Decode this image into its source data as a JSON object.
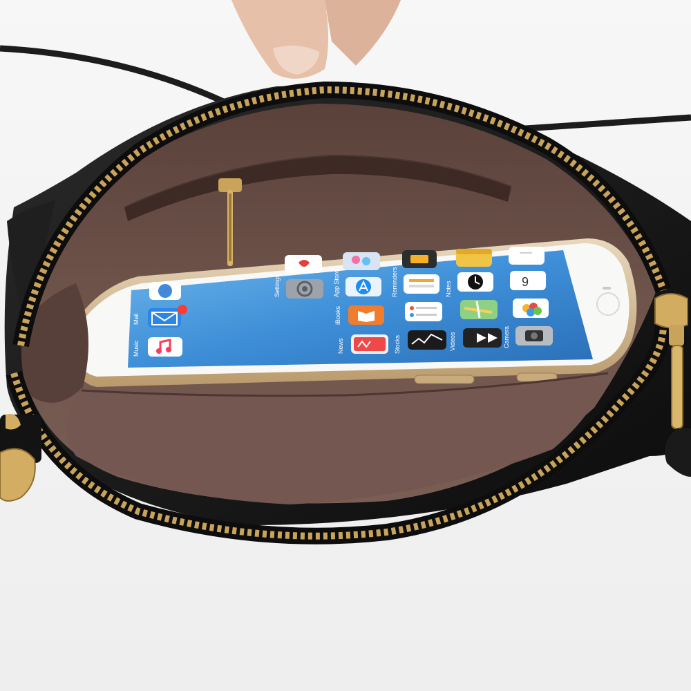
{
  "colors": {
    "background": "#f4f4f4",
    "bag_leather": "#141414",
    "lining": "#6b5048",
    "zipper_gold": "#c9a35a",
    "phone_gold": "#d8bf9a",
    "screen_blue": "#3e8fd8"
  },
  "icons": [
    "mail-icon",
    "music-icon",
    "safari-icon",
    "weather-icon",
    "settings-icon",
    "app-store-icon",
    "ibooks-icon",
    "news-icon",
    "reminders-icon",
    "stocks-icon",
    "notes-icon",
    "clock-icon",
    "maps-icon",
    "videos-icon",
    "photos-icon",
    "camera-icon"
  ],
  "apps": [
    {
      "label": "Mail"
    },
    {
      "label": "Music"
    },
    {
      "label": "Settings"
    },
    {
      "label": "App Store"
    },
    {
      "label": "iBooks"
    },
    {
      "label": "News"
    },
    {
      "label": "Reminders"
    },
    {
      "label": "Stocks"
    },
    {
      "label": "Notes"
    },
    {
      "label": "Videos"
    },
    {
      "label": "Camera"
    }
  ]
}
